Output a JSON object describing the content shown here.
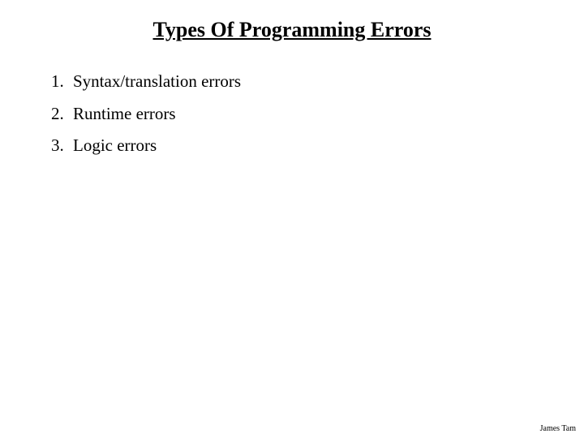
{
  "slide": {
    "title": "Types Of Programming Errors",
    "items": [
      "Syntax/translation errors",
      "Runtime errors",
      "Logic errors"
    ],
    "author": "James Tam"
  }
}
